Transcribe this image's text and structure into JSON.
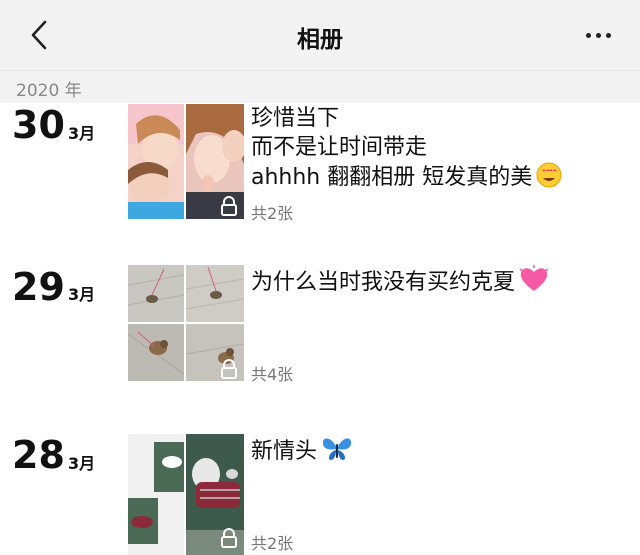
{
  "header": {
    "title": "相册",
    "back_icon": "chevron-left-icon",
    "more_icon": "more-dots-icon"
  },
  "year_label": "2020 年",
  "entries": [
    {
      "day": "30",
      "month": "3月",
      "lines": [
        "珍惜当下",
        "而不是让时间带走",
        "ahhhh 翻翻相册 短发真的美"
      ],
      "emoji": "smiling-heart-eyes-emoji",
      "count": "共2张",
      "photo_count": 2
    },
    {
      "day": "29",
      "month": "3月",
      "lines": [
        "为什么当时我没有买约克夏"
      ],
      "emoji": "pink-heart-emoji",
      "count": "共4张",
      "photo_count": 4
    },
    {
      "day": "28",
      "month": "3月",
      "lines": [
        "新情头"
      ],
      "emoji": "butterfly-emoji",
      "count": "共2张",
      "photo_count": 2
    }
  ]
}
